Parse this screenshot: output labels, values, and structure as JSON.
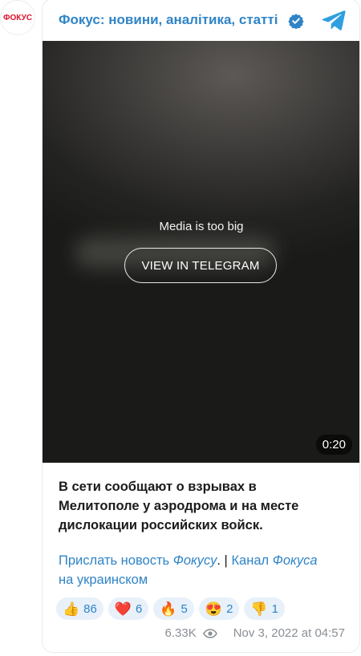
{
  "avatar": {
    "logo_text": "ФОКУС"
  },
  "header": {
    "title": "Фокус: новини, аналітика, статті"
  },
  "media": {
    "message": "Media is too big",
    "button_label": "VIEW IN TELEGRAM",
    "duration": "0:20"
  },
  "post": {
    "text": "В сети сообщают о взрывах в Мелитополе у аэродрома и на месте дислокации российских войск.",
    "link1_a": "Прислать новость ",
    "link1_b": "Фокусу",
    "link1_c": ".",
    "separator": " | ",
    "link2_a": "Канал ",
    "link2_b": "Фокуса",
    "link2_c": " на украинском"
  },
  "reactions": [
    {
      "emoji": "👍",
      "count": "86"
    },
    {
      "emoji": "❤️",
      "count": "6"
    },
    {
      "emoji": "🔥",
      "count": "5"
    },
    {
      "emoji": "😍",
      "count": "2"
    },
    {
      "emoji": "👎",
      "count": "1"
    }
  ],
  "meta": {
    "views": "6.33K",
    "date": "Nov 3, 2022 at 04:57"
  },
  "colors": {
    "accent": "#2f84c6",
    "logo": "#e0102c",
    "reaction_bg": "#e8f1fa"
  },
  "icons": {
    "verified": "verified-badge-icon",
    "telegram": "telegram-logo-icon",
    "views": "eye-icon"
  }
}
